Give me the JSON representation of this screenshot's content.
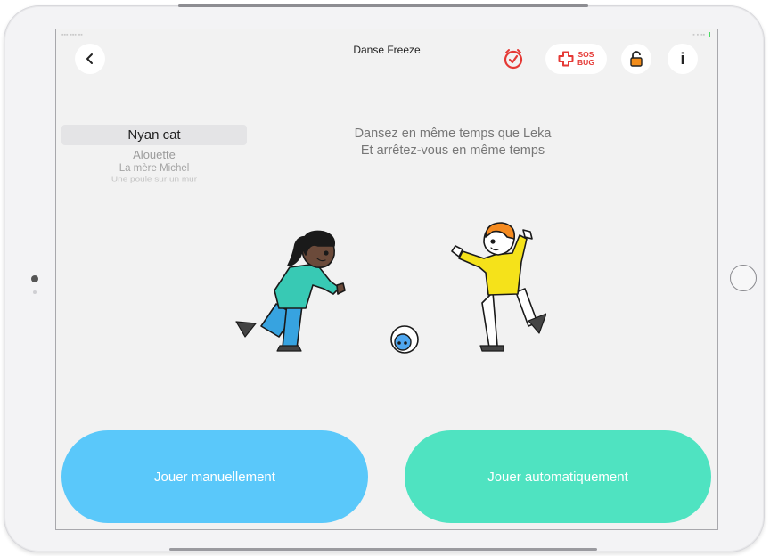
{
  "header": {
    "title": "Danse Freeze",
    "sos_line1": "SOS",
    "sos_line2": "BUG",
    "info_label": "i"
  },
  "songs": {
    "selected": "Nyan cat",
    "items": [
      "Alouette",
      "La mère Michel",
      "Une poule sur un mur"
    ]
  },
  "instructions": {
    "line1": "Dansez en même temps que Leka",
    "line2": "Et arrêtez-vous en même temps"
  },
  "buttons": {
    "manual": "Jouer manuellement",
    "auto": "Jouer automatiquement"
  },
  "colors": {
    "manual_button": "#5ac8fa",
    "auto_button": "#4fe3c1",
    "alert_red": "#e53935",
    "lock_orange": "#f28c1a"
  },
  "icons": [
    "chevron-left-icon",
    "timer-icon",
    "sos-plus-icon",
    "unlock-icon",
    "info-icon"
  ]
}
